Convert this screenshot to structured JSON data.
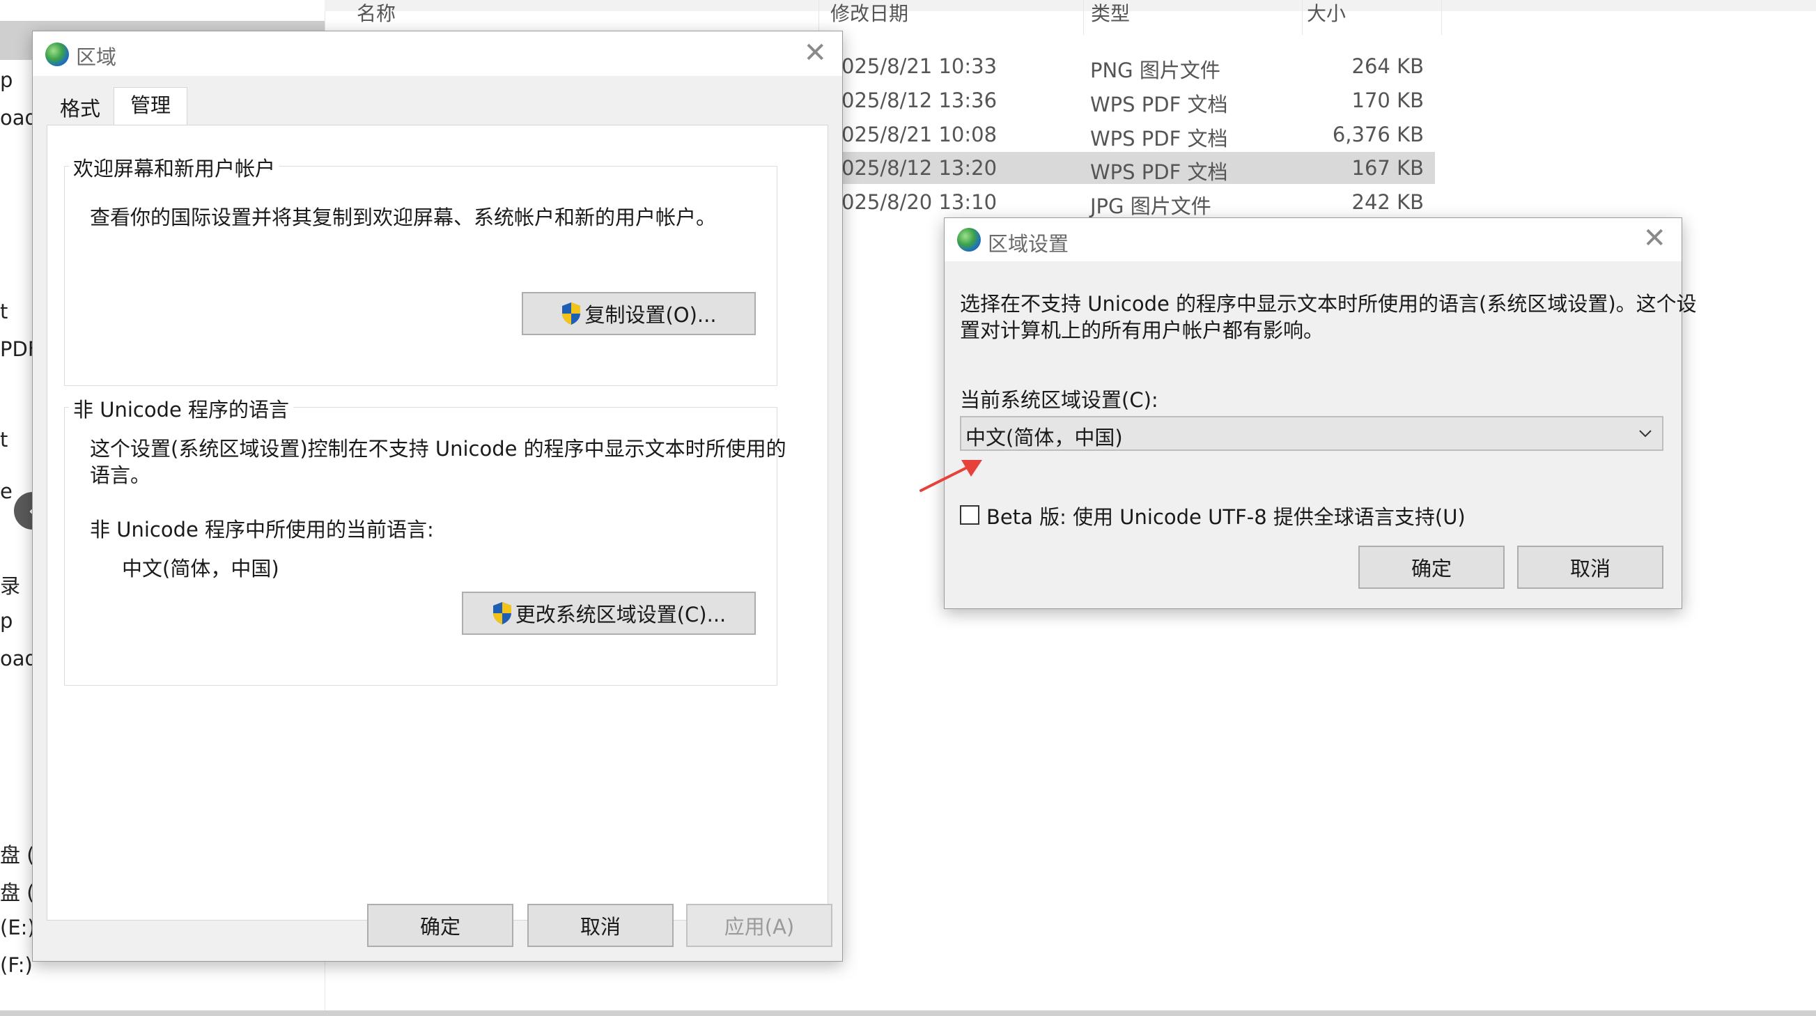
{
  "explorer": {
    "nav_fragments": [
      "p",
      "oad",
      "t",
      "PDF",
      "t",
      "e",
      "录",
      "p",
      "oad",
      "盘 (C",
      "盘 (D",
      "(E:)",
      "(F:)"
    ],
    "columns": {
      "name": "名称",
      "modified": "修改日期",
      "type": "类型",
      "size": "大小"
    },
    "files": [
      {
        "date": "025/8/21 10:33",
        "type": "PNG 图片文件",
        "size": "264 KB"
      },
      {
        "date": "025/8/12 13:36",
        "type": "WPS PDF 文档",
        "size": "170 KB"
      },
      {
        "date": "025/8/21 10:08",
        "type": "WPS PDF 文档",
        "size": "6,376 KB"
      },
      {
        "date": "025/8/12 13:20",
        "type": "WPS PDF 文档",
        "size": "167 KB"
      },
      {
        "date": "025/8/20 13:10",
        "type": "JPG 图片文件",
        "size": "242 KB"
      }
    ]
  },
  "region_dialog": {
    "title": "区域",
    "tabs": [
      "格式",
      "管理"
    ],
    "welcome_group": {
      "legend": "欢迎屏幕和新用户帐户",
      "description": "查看你的国际设置并将其复制到欢迎屏幕、系统帐户和新的用户帐户。",
      "copy_button": "复制设置(O)..."
    },
    "unicode_group": {
      "legend": "非 Unicode 程序的语言",
      "description_line1": "这个设置(系统区域设置)控制在不支持 Unicode 的程序中显示文本时所使用的",
      "description_line2": "语言。",
      "current_label": "非 Unicode 程序中所使用的当前语言:",
      "current_value": "中文(简体，中国)",
      "change_button": "更改系统区域设置(C)..."
    },
    "ok": "确定",
    "cancel": "取消",
    "apply": "应用(A)"
  },
  "locale_dialog": {
    "title": "区域设置",
    "description_line1": "选择在不支持 Unicode 的程序中显示文本时所使用的语言(系统区域设置)。这个设",
    "description_line2": "置对计算机上的所有用户帐户都有影响。",
    "current_label": "当前系统区域设置(C):",
    "current_value": "中文(简体，中国)",
    "beta_label": "Beta 版: 使用 Unicode UTF-8 提供全球语言支持(U)",
    "beta_checked": false,
    "ok": "确定",
    "cancel": "取消"
  },
  "colors": {
    "annotation_arrow": "#e8403a",
    "shield_blue": "#1e5fb4",
    "shield_yellow": "#f2c318"
  }
}
